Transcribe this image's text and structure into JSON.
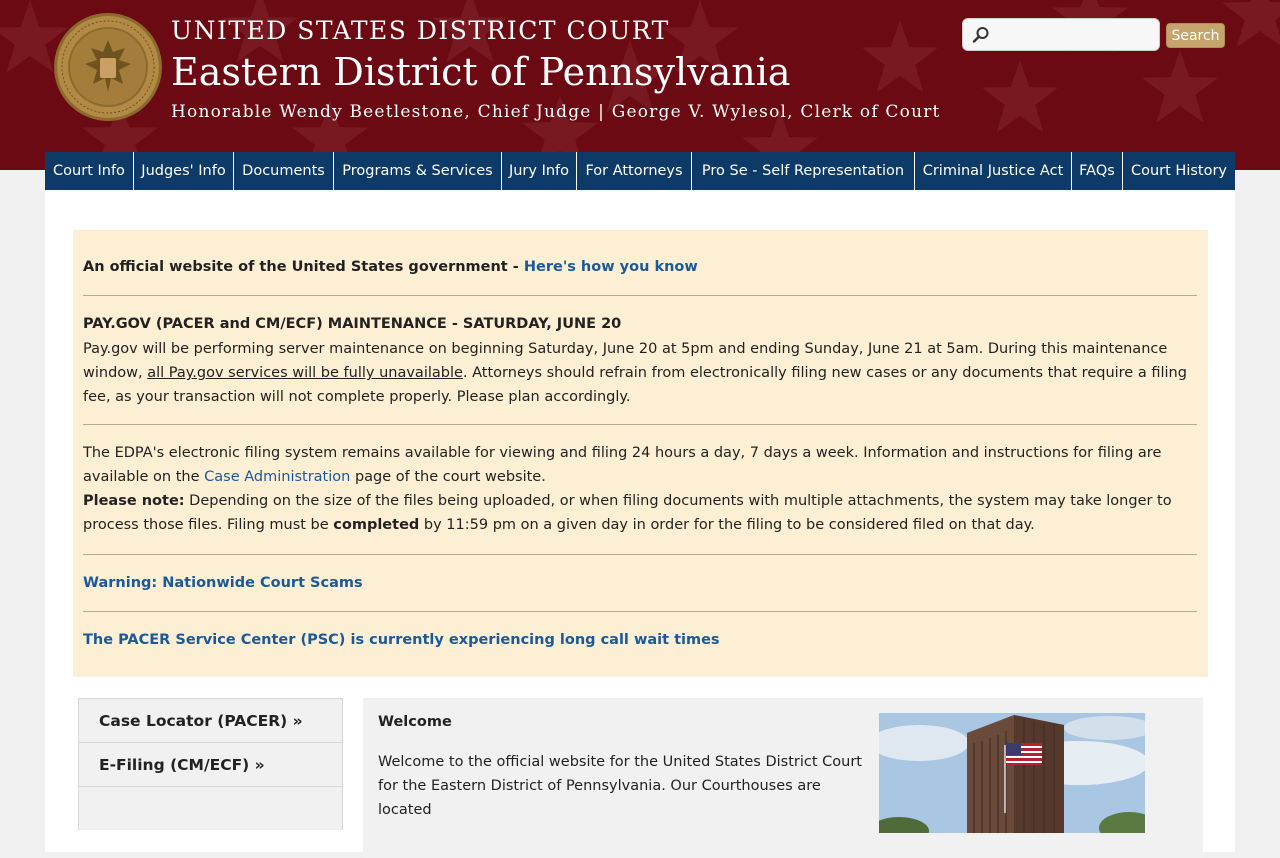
{
  "header": {
    "line1": "UNITED STATES DISTRICT COURT",
    "line2": "Eastern District of Pennsylvania",
    "line3": "Honorable Wendy Beetlestone, Chief Judge | George V. Wylesol, Clerk of Court",
    "search_placeholder": "",
    "search_button": "Search"
  },
  "nav": [
    {
      "label": "Court Info"
    },
    {
      "label": "Judges' Info"
    },
    {
      "label": "Documents"
    },
    {
      "label": "Programs & Services"
    },
    {
      "label": "Jury Info"
    },
    {
      "label": "For Attorneys"
    },
    {
      "label": "Pro Se - Self Representation"
    },
    {
      "label": "Criminal Justice Act"
    },
    {
      "label": "FAQs"
    },
    {
      "label": "Court History"
    }
  ],
  "alert": {
    "official_text": "An official website of the United States government - ",
    "official_link": "Here's how you know",
    "paygov_title": "PAY.GOV (PACER and CM/ECF) MAINTENANCE - SATURDAY, JUNE 20",
    "paygov_text_a": "Pay.gov will be performing server maintenance on beginning Saturday, June 20 at 5pm and ending Sunday, June 21 at 5am. During this maintenance window, ",
    "paygov_text_u": "all Pay.gov services will be fully unavailable",
    "paygov_text_b": ". Attorneys should refrain from electronically filing new cases or any documents that require a filing fee, as your transaction will not complete properly. Please plan accordingly.",
    "edpa_text_a": "The EDPA's electronic filing system remains available for viewing and filing 24 hours a day, 7 days a week. Information and instructions for filing are available on the ",
    "edpa_link": "Case Administration",
    "edpa_text_b": " page of the court website.",
    "note_label": "Please note:",
    "note_text_a": " Depending on the size of the files being uploaded, or when filing documents with multiple attachments, the system may take longer to process those files. Filing must be ",
    "note_bold": "completed",
    "note_text_b": " by 11:59 pm on a given day in order for the filing to be considered filed on that day.",
    "warning_link": "Warning: Nationwide Court Scams",
    "pacer_link": "The PACER Service Center (PSC) is currently experiencing long call wait times"
  },
  "quick_links": [
    {
      "label": "Case Locator (PACER) »"
    },
    {
      "label": "E-Filing (CM/ECF) »"
    }
  ],
  "welcome": {
    "title": "Welcome",
    "text": "Welcome to the official website for the United States District Court for the Eastern District of Pennsylvania. Our Courthouses are located"
  },
  "colors": {
    "header_bg": "#6b0a12",
    "nav_bg": "#0d3a66",
    "alert_bg": "#fdefd3",
    "link": "#1a5a9a",
    "search_button": "#c5a46e"
  }
}
